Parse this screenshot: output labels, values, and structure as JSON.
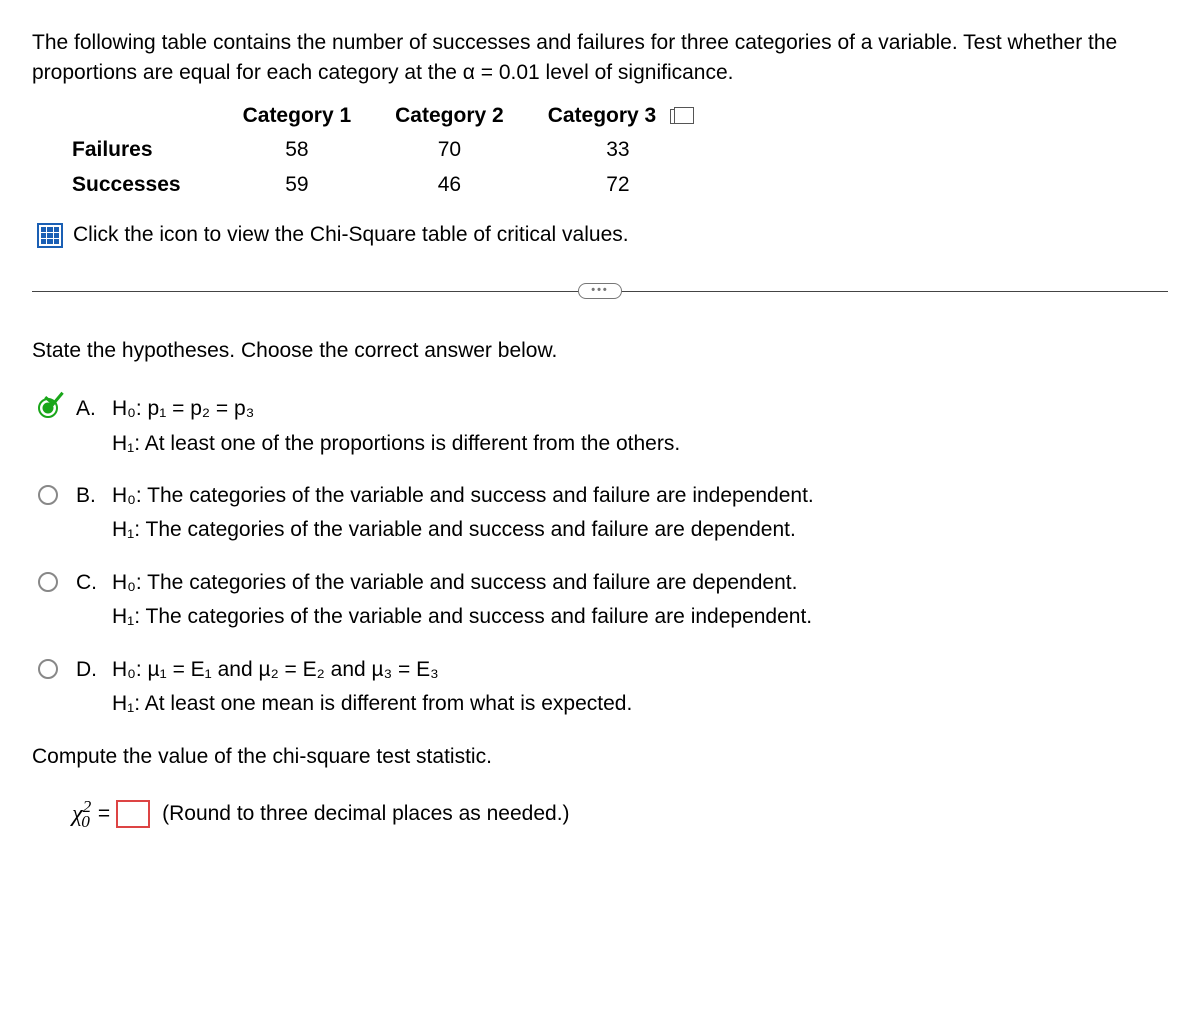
{
  "intro": "The following table contains the number of successes and failures for three categories of a variable. Test whether the proportions are equal for each category at the α = 0.01 level of significance.",
  "table": {
    "headers": [
      "",
      "Category 1",
      "Category 2",
      "Category 3"
    ],
    "rows": [
      {
        "label": "Failures",
        "values": [
          "58",
          "70",
          "33"
        ]
      },
      {
        "label": "Successes",
        "values": [
          "59",
          "46",
          "72"
        ]
      }
    ]
  },
  "chisquare_link": "Click the icon to view the Chi-Square table of critical values.",
  "q_hypotheses": "State the hypotheses. Choose the correct answer below.",
  "options": {
    "A": {
      "line1": "H₀: p₁ = p₂ = p₃",
      "line2": "H₁: At least one of the proportions is different from the others."
    },
    "B": {
      "line1": "H₀: The categories of the variable and success and failure are independent.",
      "line2": "H₁: The categories of the variable and success and failure are dependent."
    },
    "C": {
      "line1": "H₀: The categories of the variable and success and failure are dependent.",
      "line2": "H₁: The categories of the variable and success and failure are independent."
    },
    "D": {
      "line1": "H₀: µ₁ = E₁ and µ₂ = E₂ and µ₃ = E₃",
      "line2": "H₁: At least one mean is different from what is expected."
    }
  },
  "lettersLabel": {
    "A": "A.",
    "B": "B.",
    "C": "C.",
    "D": "D."
  },
  "compute_q": "Compute the value of the chi-square test statistic.",
  "answer_prefix_html": "χ",
  "answer_sub": "0",
  "answer_sup": "2",
  "equals": "=",
  "hint": "(Round to three decimal places as needed.)",
  "ellipsis": "•••"
}
